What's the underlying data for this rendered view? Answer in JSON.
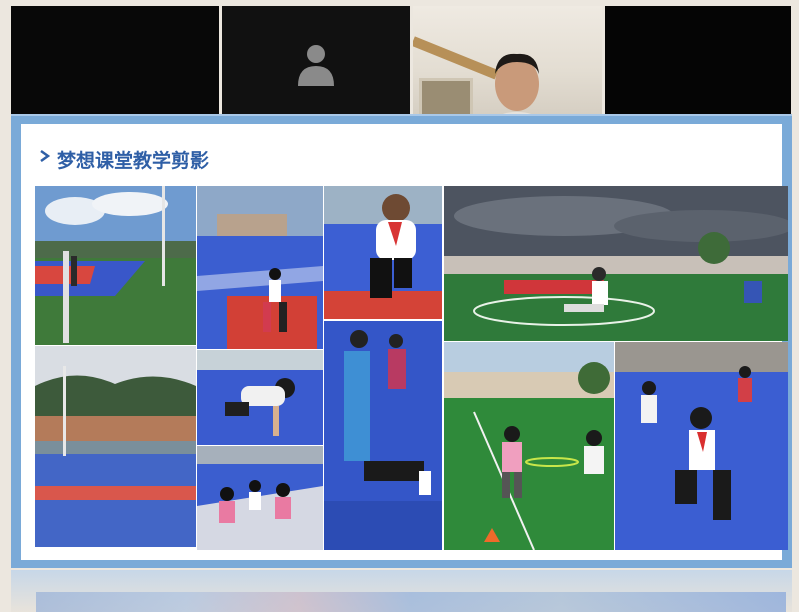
{
  "meeting": {
    "participants": [
      {
        "id": "tile-1",
        "camera": "off"
      },
      {
        "id": "tile-2",
        "camera": "off",
        "avatar": "person-silhouette-icon"
      },
      {
        "id": "tile-3",
        "camera": "on"
      },
      {
        "id": "tile-4",
        "camera": "off"
      }
    ]
  },
  "slide": {
    "title": "梦想课堂教学剪影",
    "title_icon": "arrow-bullet-icon",
    "accent_color": "#2f5fa6",
    "frame_color": "#7aaad8"
  }
}
